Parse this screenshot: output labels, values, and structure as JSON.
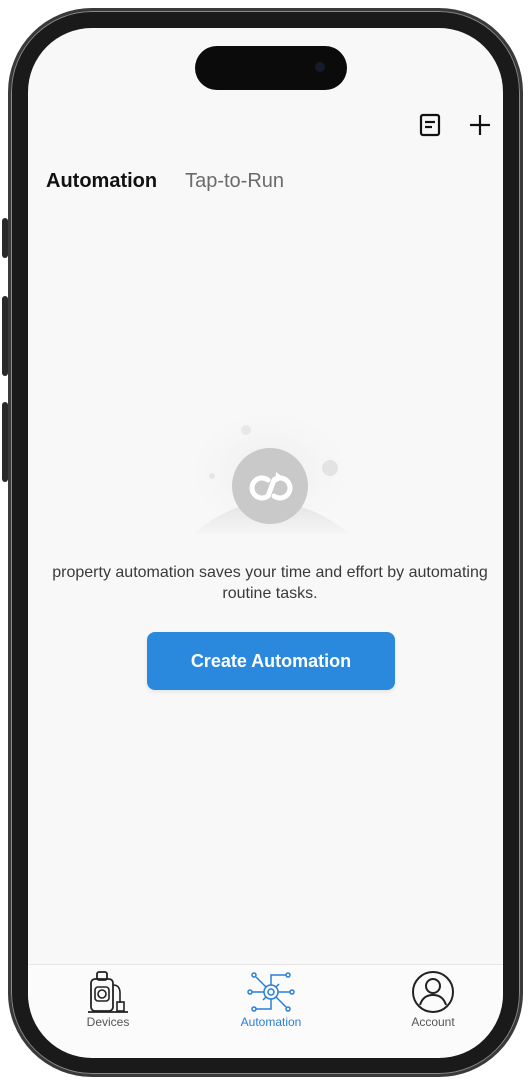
{
  "header": {
    "list_icon": "document-list-icon",
    "add_icon": "plus-icon"
  },
  "tabs": [
    {
      "label": "Automation",
      "active": true
    },
    {
      "label": "Tap-to-Run",
      "active": false
    }
  ],
  "empty_state": {
    "icon": "infinity-loop-icon",
    "message": "property automation saves your time and effort by automating routine tasks.",
    "button_label": "Create Automation"
  },
  "bottom_nav": {
    "items": [
      {
        "label": "Devices",
        "icon": "device-icon",
        "active": false
      },
      {
        "label": "Automation",
        "icon": "automation-gear-icon",
        "active": true
      },
      {
        "label": "Account",
        "icon": "account-icon",
        "active": false
      }
    ]
  },
  "colors": {
    "accent": "#2a89dd",
    "active_nav": "#2a7fd4",
    "background": "#f8f8f8"
  }
}
